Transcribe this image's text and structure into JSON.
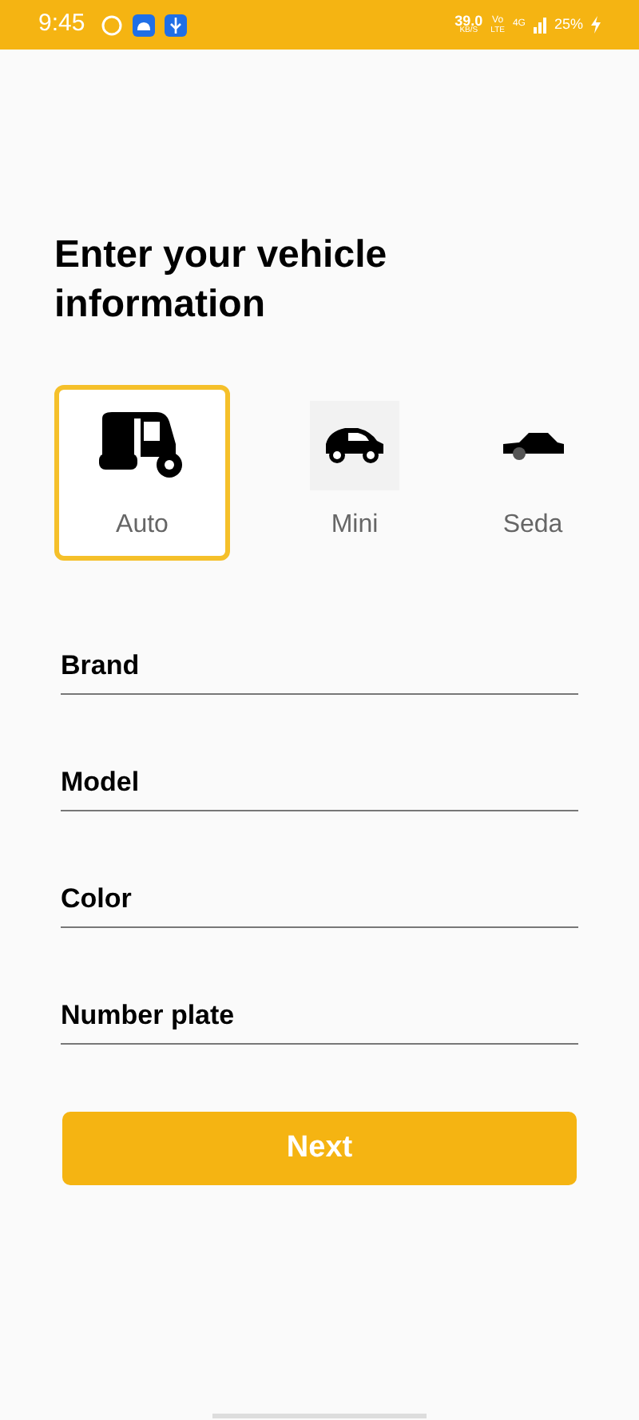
{
  "status_bar": {
    "time": "9:45",
    "speed": "39.0",
    "speed_unit": "KB/S",
    "volte_top": "Vo",
    "volte_bottom": "LTE",
    "network": "4G",
    "battery": "25%"
  },
  "title": "Enter your vehicle information",
  "vehicle_types": [
    {
      "kind": "auto",
      "label": "Auto",
      "selected": true
    },
    {
      "kind": "mini",
      "label": "Mini",
      "selected": false
    },
    {
      "kind": "sedan",
      "label": "Seda",
      "selected": false
    }
  ],
  "fields": [
    {
      "placeholder": "Brand"
    },
    {
      "placeholder": "Model"
    },
    {
      "placeholder": "Color"
    },
    {
      "placeholder": "Number plate"
    }
  ],
  "next_button": "Next"
}
